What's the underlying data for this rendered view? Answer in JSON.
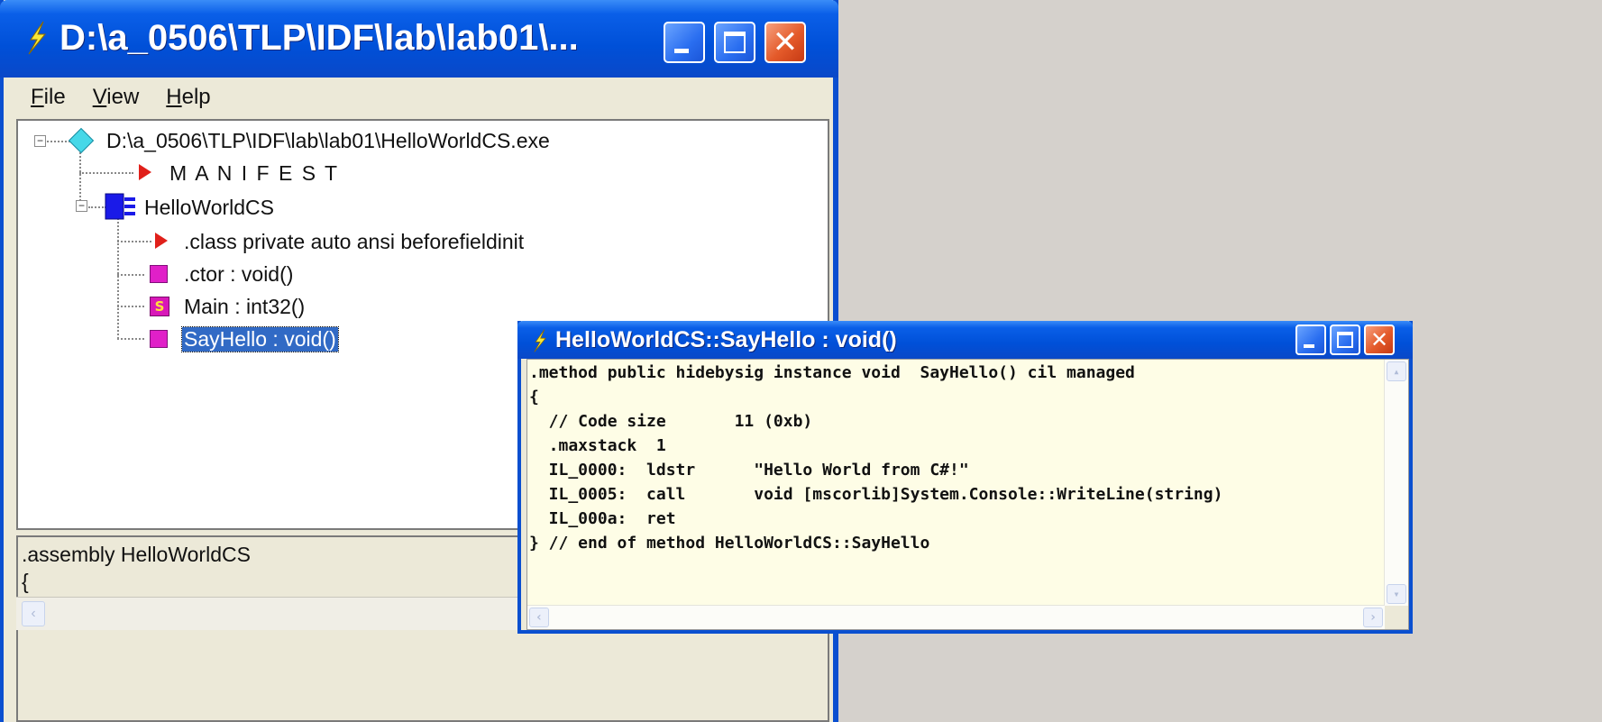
{
  "main_window": {
    "title": "D:\\a_0506\\TLP\\IDF\\lab\\lab01\\...",
    "menu": [
      {
        "label": "File",
        "mnemonic": "F",
        "rest": "ile"
      },
      {
        "label": "View",
        "mnemonic": "V",
        "rest": "iew"
      },
      {
        "label": "Help",
        "mnemonic": "H",
        "rest": "elp"
      }
    ],
    "tree": {
      "root": "D:\\a_0506\\TLP\\IDF\\lab\\lab01\\HelloWorldCS.exe",
      "manifest": "M A N I F E S T",
      "class_name": "HelloWorldCS",
      "class_decl": ".class private auto ansi beforefieldinit",
      "ctor": ".ctor : void()",
      "main_method": "Main : int32()",
      "sayhello": "SayHello : void()"
    },
    "source_preview": {
      "line1": ".assembly HelloWorldCS",
      "line2": "{"
    }
  },
  "il_window": {
    "title": "HelloWorldCS::SayHello : void()",
    "lines": [
      ".method public hidebysig instance void  SayHello() cil managed",
      "{",
      "  // Code size       11 (0xb)",
      "  .maxstack  1",
      "  IL_0000:  ldstr      \"Hello World from C#!\"",
      "  IL_0005:  call       void [mscorlib]System.Console::WriteLine(string)",
      "  IL_000a:  ret",
      "} // end of method HelloWorldCS::SayHello"
    ]
  },
  "icons": {
    "title_icon": "lightning-icon",
    "assembly": "diamond-icon",
    "manifest": "red-triangle-icon",
    "class": "class-icon",
    "method": "method-icon",
    "static_method": "static-method-icon"
  },
  "colors": {
    "titlebar_blue": "#0050d8",
    "selection": "#316ac5",
    "il_background": "#fefde6",
    "method_magenta": "#e020c8",
    "close_red": "#e45a2a"
  }
}
